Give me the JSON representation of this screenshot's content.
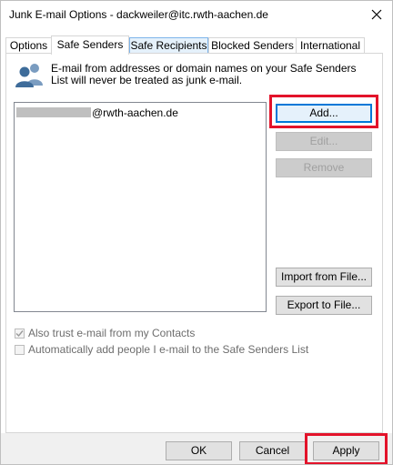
{
  "window": {
    "title": "Junk E-mail Options - dackweiler@itc.rwth-aachen.de"
  },
  "tabs": [
    {
      "label": "Options"
    },
    {
      "label": "Safe Senders"
    },
    {
      "label": "Safe Recipients"
    },
    {
      "label": "Blocked Senders"
    },
    {
      "label": "International"
    }
  ],
  "info": {
    "text": "E-mail from addresses or domain names on your Safe Senders List will never be treated as junk e-mail."
  },
  "list": {
    "items": [
      {
        "visible_suffix": "@rwth-aachen.de"
      }
    ]
  },
  "buttons": {
    "add": "Add...",
    "edit": "Edit...",
    "remove": "Remove",
    "import": "Import from File...",
    "export": "Export to File..."
  },
  "options": {
    "trust_contacts": {
      "label": "Also trust e-mail from my Contacts",
      "checked": true,
      "enabled": false
    },
    "auto_add": {
      "label": "Automatically add people I e-mail to the Safe Senders List",
      "checked": false,
      "enabled": false
    }
  },
  "footer": {
    "ok": "OK",
    "cancel": "Cancel",
    "apply": "Apply"
  },
  "colors": {
    "highlight": "#e3132a",
    "focus": "#0078d7"
  }
}
